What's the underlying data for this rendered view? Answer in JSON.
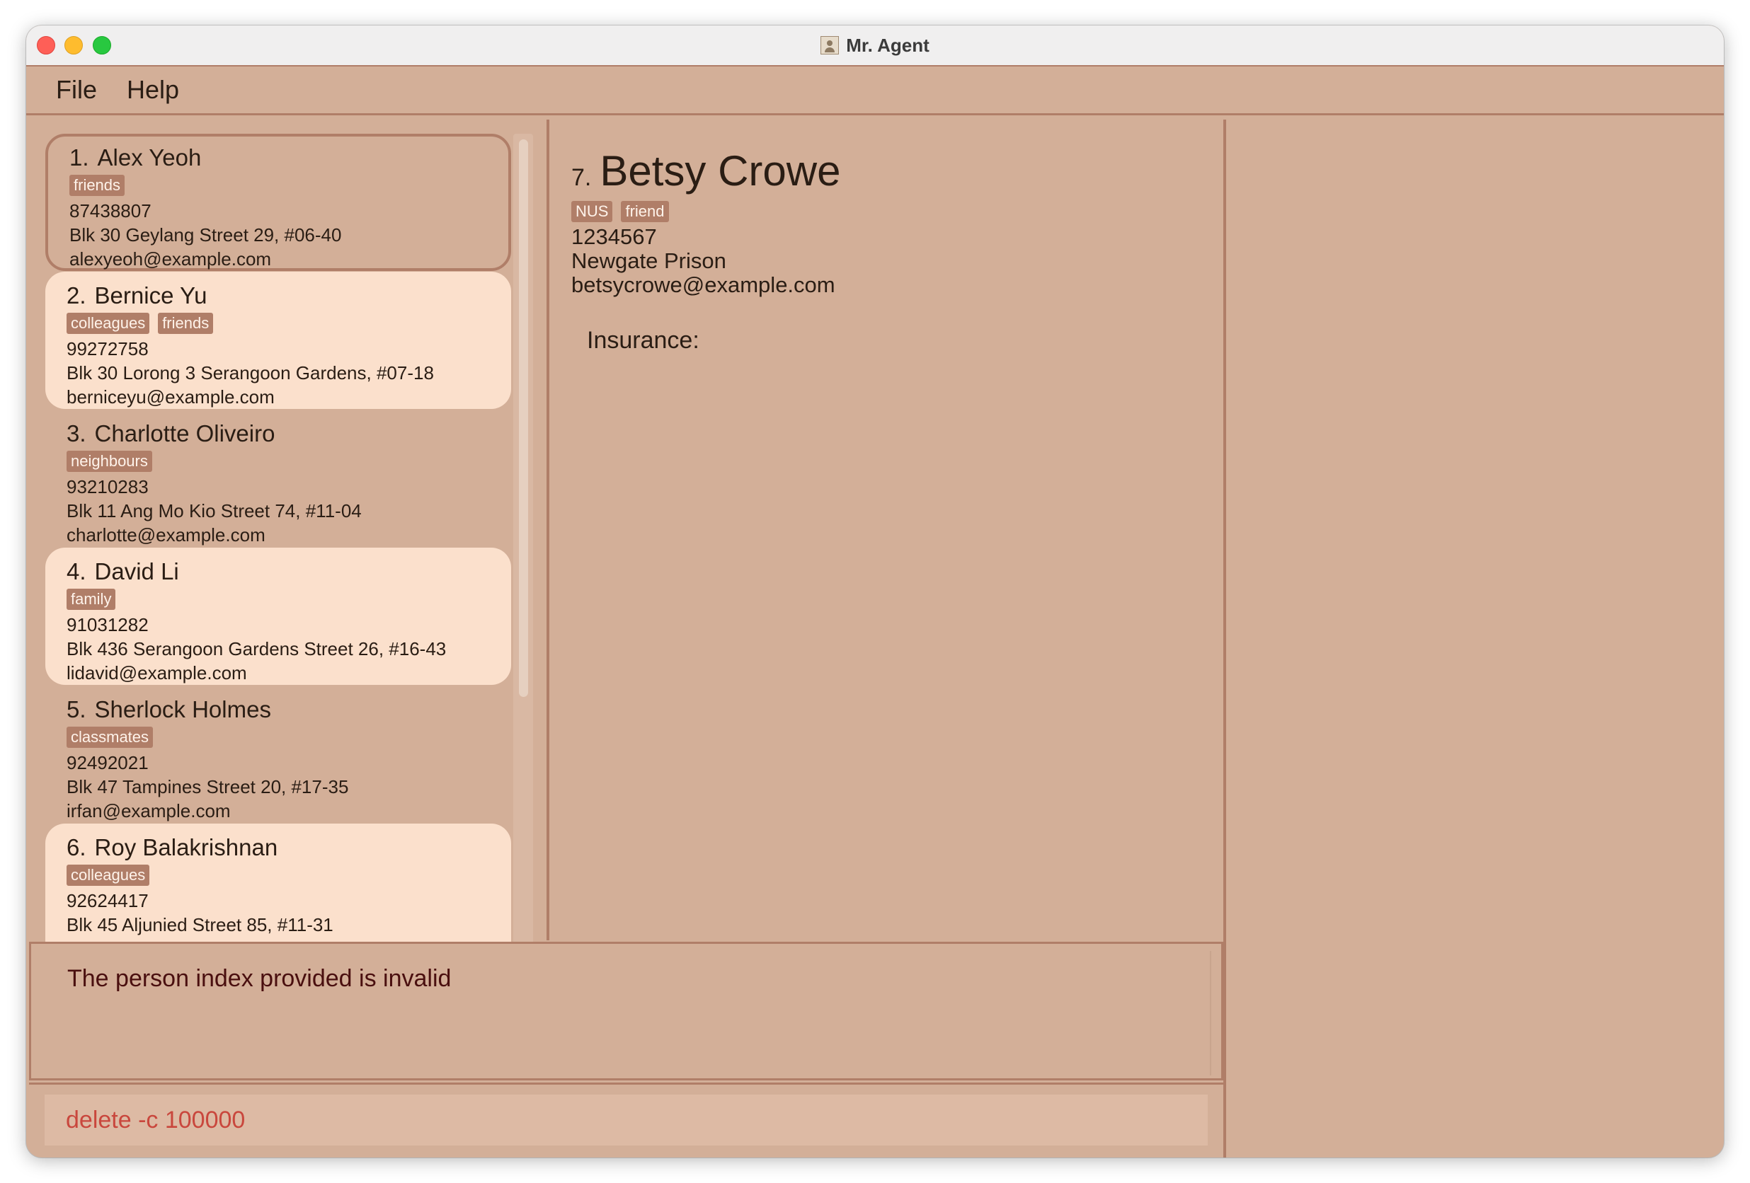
{
  "window": {
    "title": "Mr. Agent"
  },
  "menu": {
    "file": "File",
    "help": "Help"
  },
  "persons": [
    {
      "index": "1.",
      "name": "Alex Yeoh",
      "tags": [
        "friends"
      ],
      "phone": "87438807",
      "address": "Blk 30 Geylang Street 29, #06-40",
      "email": "alexyeoh@example.com"
    },
    {
      "index": "2.",
      "name": "Bernice Yu",
      "tags": [
        "colleagues",
        "friends"
      ],
      "phone": "99272758",
      "address": "Blk 30 Lorong 3 Serangoon Gardens, #07-18",
      "email": "berniceyu@example.com"
    },
    {
      "index": "3.",
      "name": "Charlotte Oliveiro",
      "tags": [
        "neighbours"
      ],
      "phone": "93210283",
      "address": "Blk 11 Ang Mo Kio Street 74, #11-04",
      "email": "charlotte@example.com"
    },
    {
      "index": "4.",
      "name": "David Li",
      "tags": [
        "family"
      ],
      "phone": "91031282",
      "address": "Blk 436 Serangoon Gardens Street 26, #16-43",
      "email": "lidavid@example.com"
    },
    {
      "index": "5.",
      "name": "Sherlock Holmes",
      "tags": [
        "classmates"
      ],
      "phone": "92492021",
      "address": "Blk 47 Tampines Street 20, #17-35",
      "email": "irfan@example.com"
    },
    {
      "index": "6.",
      "name": "Roy Balakrishnan",
      "tags": [
        "colleagues"
      ],
      "phone": "92624417",
      "address": "Blk 45 Aljunied Street 85, #11-31",
      "email": ""
    }
  ],
  "detail": {
    "index": "7.",
    "name": "Betsy Crowe",
    "tags": [
      "NUS",
      "friend"
    ],
    "phone": "1234567",
    "address": "Newgate Prison",
    "email": "betsycrowe@example.com",
    "insurance_label": "Insurance:"
  },
  "result": {
    "message": "The person index provided is invalid"
  },
  "command": {
    "value": "delete -c 100000"
  },
  "colors": {
    "background": "#d3af98",
    "card_alt": "#fbe0cc",
    "accent": "#b07e68",
    "error_text": "#c9473d"
  }
}
